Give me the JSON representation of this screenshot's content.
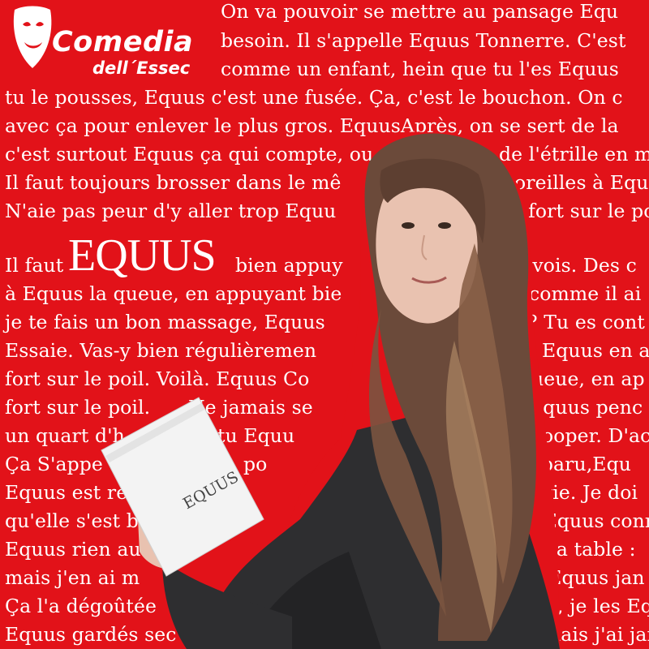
{
  "poster": {
    "logo": {
      "name": "Comedia",
      "subtitle": "dell´Essec"
    },
    "headline": "EQUUS",
    "background_color": "#e21219",
    "text_color": "#ffffff",
    "text_lines": [
      "On va pouvoir se mettre au pansage Equ",
      "besoin. Il s'appelle Equus Tonnerre. C'est",
      "comme un enfant, hein que tu l'es Equus",
      "tu le pousses, Equus c'est une fusée. Ça, c'est le bouchon. On c",
      "avec ça pour enlever le plus gros. EquusAprès, on se sert de la",
      "c'est surtout Equus ça qui compte, ou",
      "Il faut toujours brosser dans le mê",
      "N'aie pas peur d'y aller trop Equu",
      "Il faut",
      "à Equus la queue, en appuyant bie",
      "je te fais un bon massage, Equus",
      "Essaie. Vas-y bien régulièremen",
      "fort sur le poil. Voilà. Equus Co",
      "fort sur le poil.",
      "un quart d'h",
      "Ça S'appe",
      "Equus est re",
      "qu'elle s'est b",
      "Equus rien au",
      "mais j'en ai m",
      "Ça l'a dégoûtée",
      "Equus gardés sec"
    ],
    "text_fragments_right": {
      "line_6": "de l'étrille en mê",
      "line_7": "oreilles à Equ",
      "line_8": "t fort sur le po",
      "line_9": "bien appuy",
      "line_9b": "tu vois. Des c",
      "line_10": "comme il ai",
      "line_11": "? Tu es cont",
      "line_12": "Equus en a",
      "line_13": "ueue, en ap",
      "line_14a": "Ne jamais se",
      "line_14": "Equus penc",
      "line_15a": "tu Equu",
      "line_15": "ooper. D'ac",
      "line_16a": "po",
      "line_16": "disparu,Equ",
      "line_17": "sa vie. Je doi",
      "line_18": "e Equus conn",
      "line_19": "sur la table :",
      "line_20": "est Equus jan",
      "line_21": "vous, je les Eq",
      "line_22": "ai, mais j'ai jam"
    },
    "script_book": {
      "title": "EQUUS"
    }
  }
}
